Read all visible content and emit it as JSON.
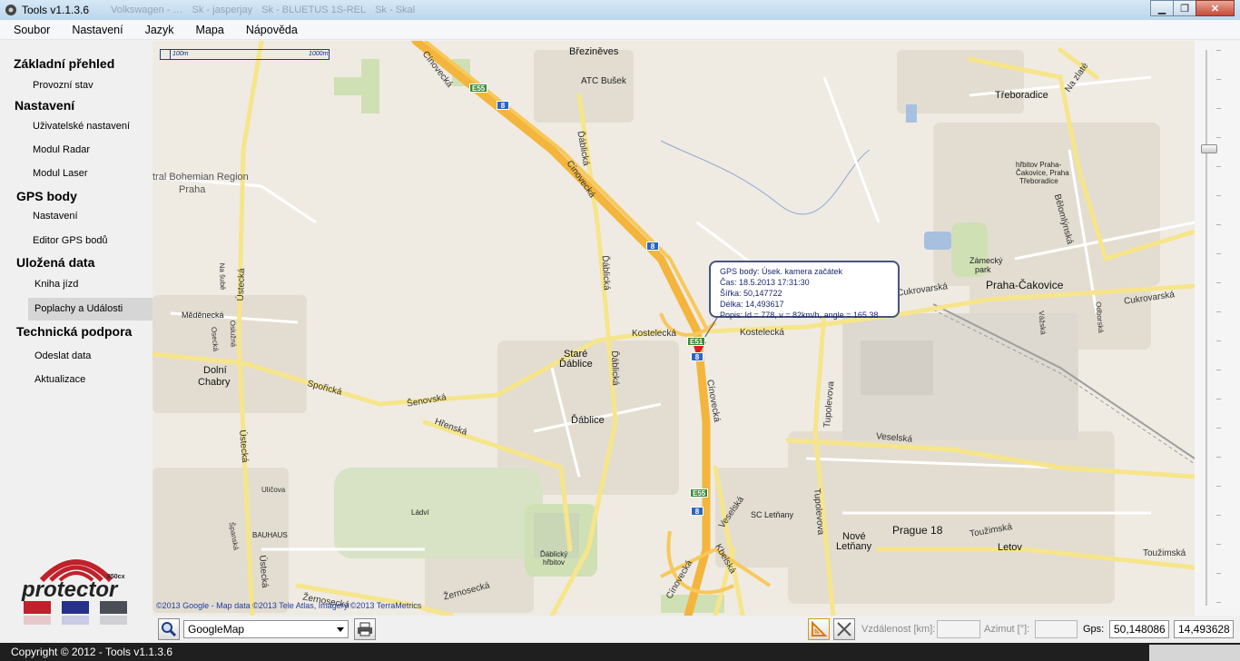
{
  "window": {
    "title": "Tools v1.1.3.6",
    "ghost_tabs": [
      "Volkswagen - …",
      "Sk - jasperjay",
      "Sk - BLUETUS 1S-REL",
      "Sk - Skal"
    ],
    "buttons": {
      "minimize": "▁",
      "maximize": "❐",
      "close": "✕"
    }
  },
  "menu": [
    "Soubor",
    "Nastavení",
    "Jazyk",
    "Mapa",
    "Nápověda"
  ],
  "sidebar": {
    "sections": [
      {
        "title": "Základní přehled",
        "items": [
          "Provozní stav"
        ]
      },
      {
        "title": "Nastavení",
        "items": [
          "Uživatelské nastavení",
          "Modul Radar",
          "Modul Laser"
        ]
      },
      {
        "title": "GPS body",
        "items": [
          "Nastavení",
          "Editor GPS bodů"
        ]
      },
      {
        "title": "Uložená data",
        "items": [
          "Kniha jízd",
          "Poplachy a Události"
        ]
      },
      {
        "title": "Technická podpora",
        "items": [
          "Odeslat data",
          "Aktualizace"
        ]
      }
    ],
    "active_item": "Poplachy a Události",
    "logo": {
      "brand": "protector",
      "model": "850cx",
      "colors": [
        "#c0212b",
        "#26318a",
        "#4a4f57"
      ]
    }
  },
  "map": {
    "scale_label_short": "100m",
    "scale_label_long": "1000m",
    "copyright": "©2013 Google - Map data ©2013 Tele Atlas, Imagery ©2013 TerraMetrics",
    "popup": {
      "line1": "GPS body: Úsek. kamera začátek",
      "line2": "Čas: 18.5.2013 17:31:30",
      "line3": "Šířka: 50,147722",
      "line4": "Délka: 14,493617",
      "line5": "Popis: Id = 778, v = 82km/h, angle = 165.38"
    },
    "places": {
      "brezinenves": "Březiněves",
      "atc": "ATC Bušek",
      "treboradice": "Třeboradice",
      "central": "tral Bohemian Region",
      "praha": "Praha",
      "hrbitov_praha": "hřbitov Praha-",
      "hrbitov_cakovice": "Čakovice, Praha",
      "hrbitov_treboradice": "Třeboradice",
      "zamecky": "Zámecký",
      "park": "park",
      "praha_cakovice": "Praha-Čakovice",
      "medenecka": "Měděnecká",
      "stare": "Staré",
      "dablice_stare": "Ďáblice",
      "dolni": "Dolní",
      "chabry": "Chabry",
      "dablice": "Ďáblice",
      "sc_letnany": "SC Letňany",
      "nove": "Nové",
      "letnany": "Letňany",
      "prague18": "Prague 18",
      "letov": "Letov",
      "ladvi": "Ládví",
      "bauhaus": "BAUHAUS",
      "dablicky": "Ďáblický",
      "hrbitov": "hřbitov"
    },
    "roads": {
      "cinovecka": "Cínovecká",
      "dablicka": "Ďáblická",
      "kostelecka": "Kostelecká",
      "sporicka": "Spořická",
      "senovska": "Šenovská",
      "hrenska": "Hřenská",
      "ustecka": "Ústecká",
      "cukrovarska": "Cukrovarská",
      "tupolevova": "Tupolevova",
      "veselska": "Veselská",
      "touzimska": "Toužimská",
      "zernosecka": "Žernosecká",
      "na_zlate": "Na zlaté",
      "belomlynska": "Bělomlýnská",
      "odborska": "Odborská",
      "vazska": "Vážská",
      "na_sube": "Na šubě",
      "oseckа": "Osecká",
      "oslcuzna": "Oslužná",
      "ulicova": "Uličova",
      "spanska": "Španská",
      "kbelska": "Kbelská"
    },
    "shields": {
      "e55": "E55",
      "e51": "E51",
      "d8": "8"
    }
  },
  "toolbar": {
    "map_source": "GoogleMap",
    "distance_label": "Vzdálenost [km]:",
    "azimuth_label": "Azimut [°]:",
    "gps_label": "Gps:",
    "gps_lat": "50,148086",
    "gps_lon": "14,493628"
  },
  "status": {
    "copyright": "Copyright © 2012 - Tools v1.1.3.6"
  }
}
